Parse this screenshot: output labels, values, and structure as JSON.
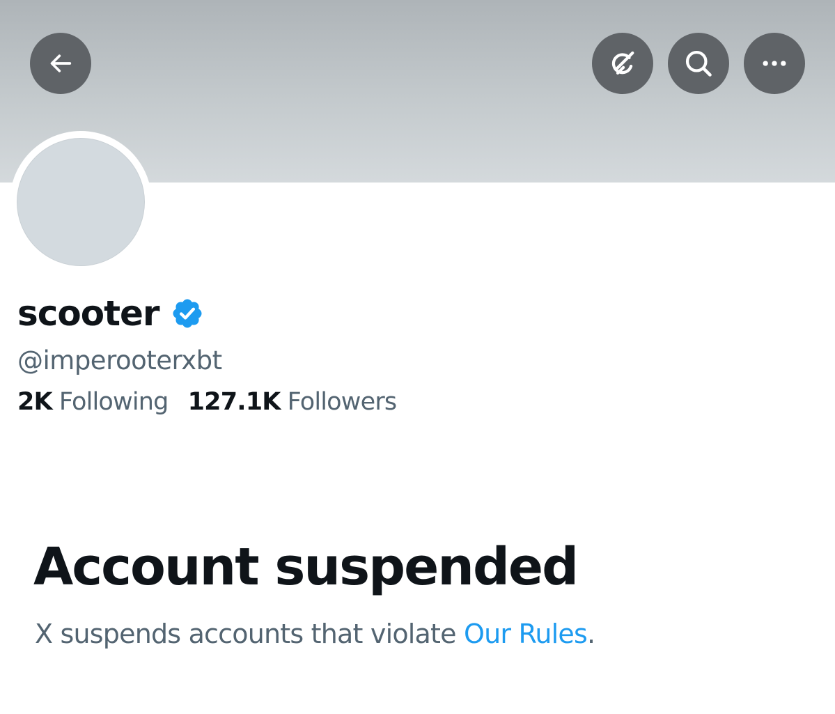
{
  "header": {
    "back_icon": "arrow-left-icon",
    "grok_icon": "grok-icon",
    "search_icon": "search-icon",
    "more_icon": "more-horizontal-icon",
    "button_color": "#5f6367",
    "banner_color": "#c4cacd"
  },
  "profile": {
    "display_name": "scooter",
    "verified_icon": "verified-badge-icon",
    "verified_color": "#1d9bf0",
    "handle": "@imperooterxbt",
    "following_count": "2K",
    "following_label": "Following",
    "followers_count": "127.1K",
    "followers_label": "Followers"
  },
  "suspension": {
    "title": "Account suspended",
    "message_prefix": "X suspends accounts that violate ",
    "rules_link": "Our Rules",
    "message_suffix": "."
  },
  "colors": {
    "text_primary": "#0f1419",
    "text_secondary": "#536471",
    "link": "#1d9bf0"
  }
}
